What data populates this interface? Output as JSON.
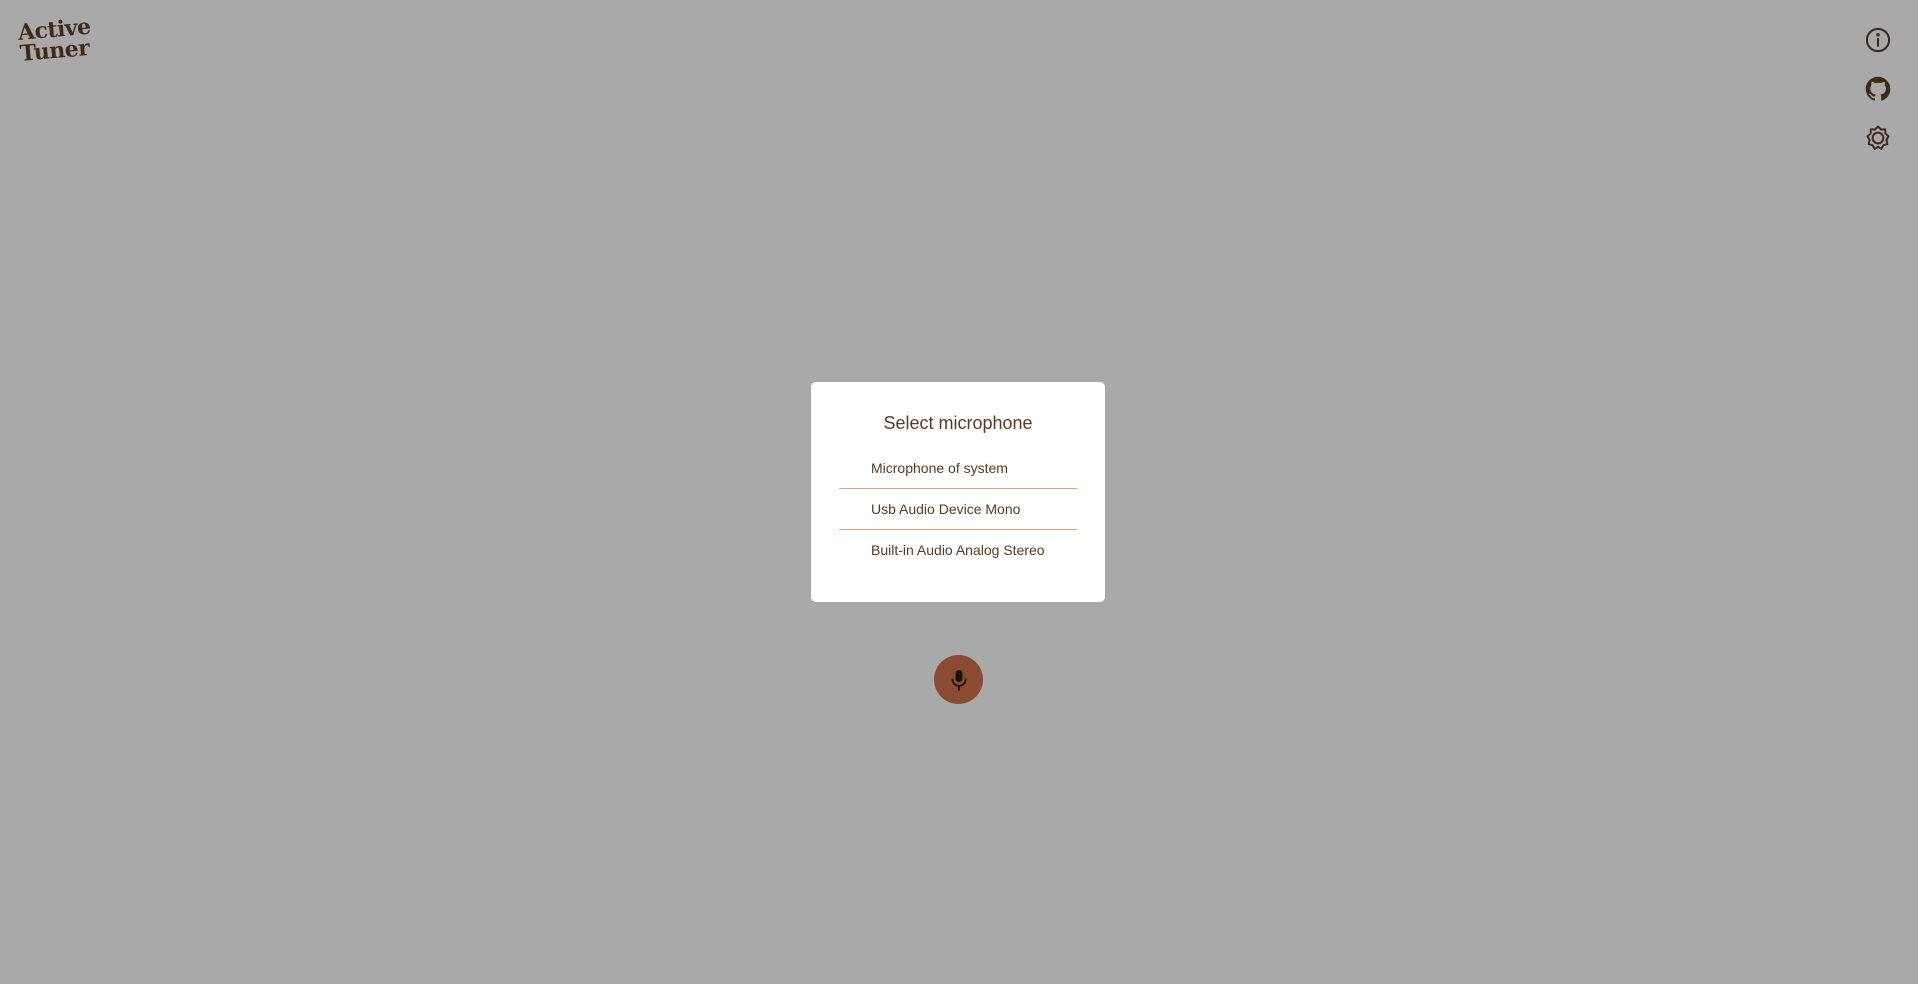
{
  "app": {
    "logo_line1": "Active",
    "logo_line2": "Tuner"
  },
  "header_icons": [
    {
      "name": "info-icon"
    },
    {
      "name": "github-icon"
    },
    {
      "name": "settings-icon"
    }
  ],
  "dialog": {
    "title": "Select microphone",
    "options": [
      "Microphone of system",
      "Usb Audio Device Mono",
      "Built-in Audio Analog Stereo"
    ]
  },
  "mic_button": {
    "icon": "microphone-icon"
  },
  "colors": {
    "background": "#a9a9a9",
    "text": "#5a3a22",
    "accent": "#8a4b32",
    "divider": "#d8a47f",
    "icon": "#3f2a1a"
  }
}
